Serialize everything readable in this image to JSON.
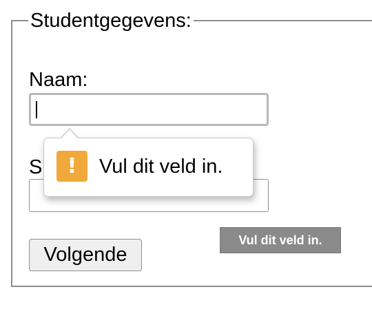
{
  "form": {
    "legend": "Studentgegevens:",
    "name_label": "Naam:",
    "name_value": "",
    "second_label_partial": "S",
    "second_value": "",
    "next_button": "Volgende"
  },
  "validation_bubble": {
    "icon": "warning-icon",
    "icon_glyph": "!",
    "icon_color": "#f2a93b",
    "message": "Vul dit veld in."
  },
  "tooltip": {
    "text": "Vul dit veld in."
  }
}
